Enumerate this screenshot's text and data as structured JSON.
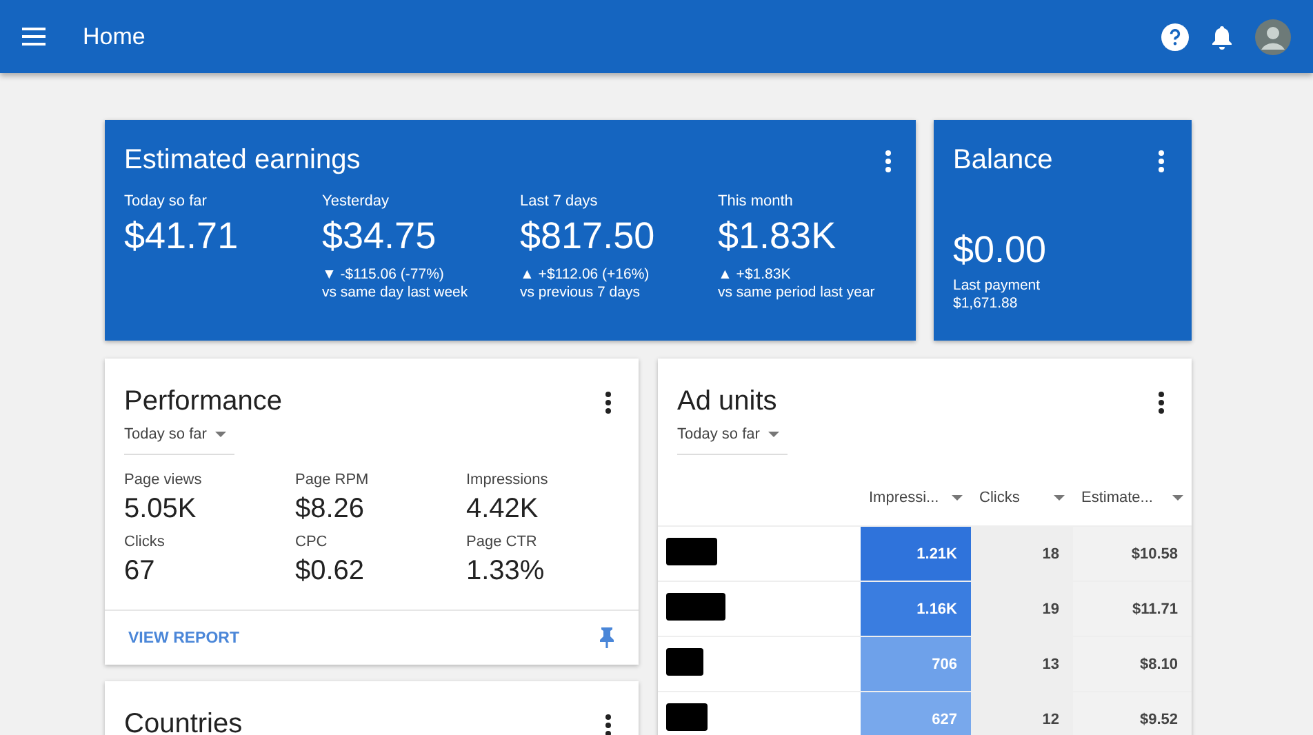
{
  "app_bar": {
    "title": "Home"
  },
  "earnings": {
    "title": "Estimated earnings",
    "metrics": [
      {
        "label": "Today so far",
        "value": "$41.71"
      },
      {
        "label": "Yesterday",
        "value": "$34.75",
        "change": "▼ -$115.06 (-77%)",
        "comparison": "vs same day last week"
      },
      {
        "label": "Last 7 days",
        "value": "$817.50",
        "change": "▲ +$112.06 (+16%)",
        "comparison": "vs previous 7 days"
      },
      {
        "label": "This month",
        "value": "$1.83K",
        "change": "▲ +$1.83K",
        "comparison": "vs same period last year"
      }
    ]
  },
  "balance": {
    "title": "Balance",
    "value": "$0.00",
    "note_label": "Last payment",
    "note_value": "$1,671.88"
  },
  "performance": {
    "title": "Performance",
    "range": "Today so far",
    "metrics": [
      {
        "label": "Page views",
        "value": "5.05K"
      },
      {
        "label": "Page RPM",
        "value": "$8.26"
      },
      {
        "label": "Impressions",
        "value": "4.42K"
      },
      {
        "label": "Clicks",
        "value": "67"
      },
      {
        "label": "CPC",
        "value": "$0.62"
      },
      {
        "label": "Page CTR",
        "value": "1.33%"
      }
    ],
    "link": "VIEW REPORT"
  },
  "ad_units": {
    "title": "Ad units",
    "range": "Today so far",
    "columns": [
      "Impressi...",
      "Clicks",
      "Estimate..."
    ],
    "rows": [
      {
        "impressions": "1.21K",
        "color": "#2f73db",
        "clicks": "18",
        "estimated": "$10.58"
      },
      {
        "impressions": "1.16K",
        "color": "#3a7de0",
        "clicks": "19",
        "estimated": "$11.71"
      },
      {
        "impressions": "706",
        "color": "#6ea1ea",
        "clicks": "13",
        "estimated": "$8.10"
      },
      {
        "impressions": "627",
        "color": "#78a8ec",
        "clicks": "12",
        "estimated": "$9.52"
      }
    ]
  },
  "countries": {
    "title": "Countries"
  }
}
